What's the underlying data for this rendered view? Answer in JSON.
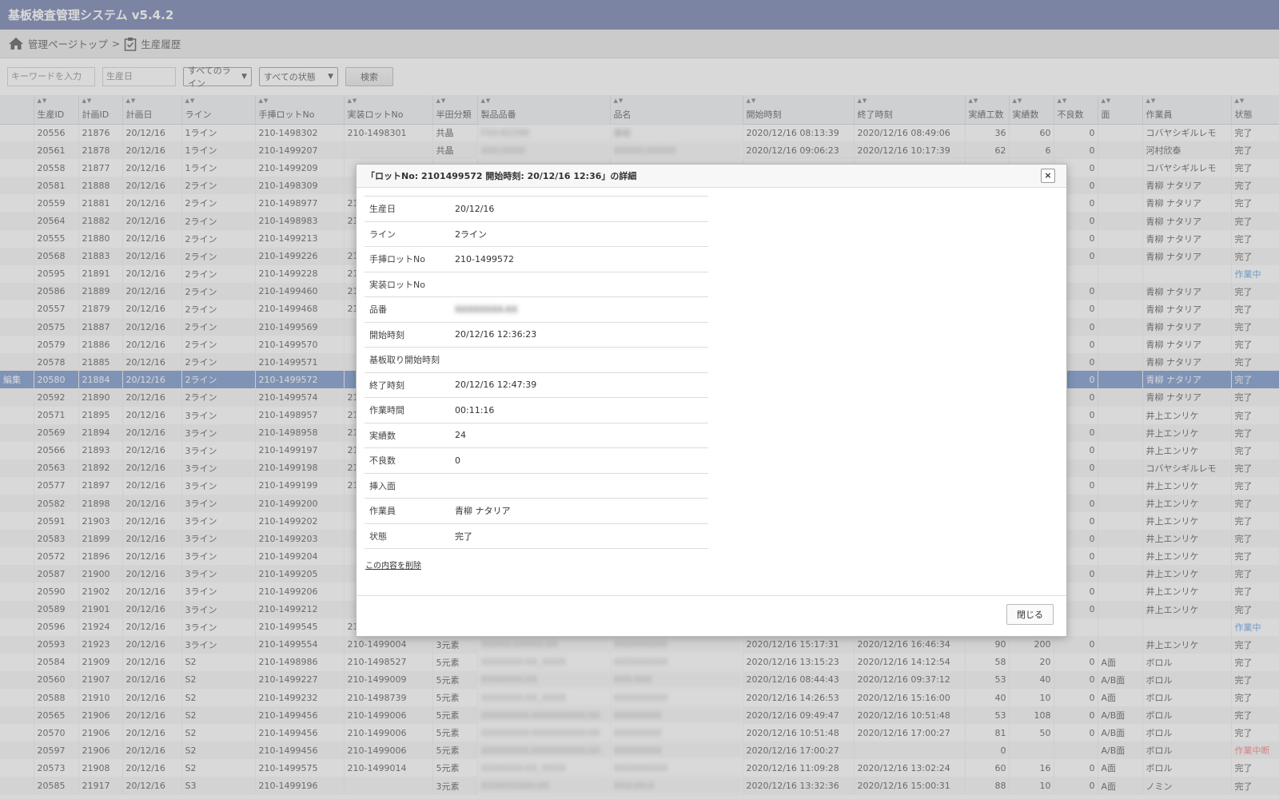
{
  "app": {
    "title": "基板検査管理システム v5.4.2"
  },
  "breadcrumb": {
    "home": "管理ページトップ",
    "separator": ">",
    "current": "生産履歴"
  },
  "search": {
    "keyword_placeholder": "キーワードを入力",
    "date_placeholder": "生産日",
    "line_select": "すべてのライン",
    "status_select": "すべての状態",
    "search_button": "検索"
  },
  "icons": {
    "home": "home-icon",
    "breadcrumb_page": "clipboard-check-icon",
    "close": "close-icon",
    "sort": "sort-arrows-icon"
  },
  "colors": {
    "header": "#56659e",
    "selected_row": "#5c80c0",
    "in_progress": "#3a8be0",
    "stopped": "#e66666"
  },
  "table": {
    "columns": [
      "",
      "生産ID",
      "計画ID",
      "計画日",
      "ライン",
      "手挿ロットNo",
      "実装ロットNo",
      "半田分類",
      "製品品番",
      "品名",
      "開始時刻",
      "終了時刻",
      "実績工数",
      "実績数",
      "不良数",
      "面",
      "作業員",
      "状態"
    ],
    "edit_label": "編集",
    "rows": [
      [
        "",
        "20556",
        "21876",
        "20/12/16",
        "1ライン",
        "210-1498302",
        "210-1498301",
        "共晶",
        "FXX-R2298",
        "基板",
        "2020/12/16 08:13:39",
        "2020/12/16 08:49:06",
        "36",
        "60",
        "0",
        "",
        "コバヤシギルレモ",
        "完了"
      ],
      [
        "",
        "20561",
        "21878",
        "20/12/16",
        "1ライン",
        "210-1499207",
        "",
        "共晶",
        "XXX-XXXX",
        "XXXXX-XXXXX",
        "2020/12/16 09:06:23",
        "2020/12/16 10:17:39",
        "62",
        "6",
        "0",
        "",
        "河村欣泰",
        "完了"
      ],
      [
        "",
        "20558",
        "21877",
        "20/12/16",
        "1ライン",
        "210-1499209",
        "",
        "",
        "",
        "",
        "",
        "",
        "",
        "",
        "0",
        "",
        "コバヤシギルレモ",
        "完了"
      ],
      [
        "",
        "20581",
        "21888",
        "20/12/16",
        "2ライン",
        "210-1498309",
        "",
        "",
        "",
        "",
        "",
        "",
        "",
        "",
        "0",
        "",
        "青柳 ナタリア",
        "完了"
      ],
      [
        "",
        "20559",
        "21881",
        "20/12/16",
        "2ライン",
        "210-1498977",
        "21",
        "",
        "",
        "",
        "",
        "",
        "",
        "",
        "0",
        "",
        "青柳 ナタリア",
        "完了"
      ],
      [
        "",
        "20564",
        "21882",
        "20/12/16",
        "2ライン",
        "210-1498983",
        "21",
        "",
        "",
        "",
        "",
        "",
        "",
        "",
        "0",
        "",
        "青柳 ナタリア",
        "完了"
      ],
      [
        "",
        "20555",
        "21880",
        "20/12/16",
        "2ライン",
        "210-1499213",
        "",
        "",
        "",
        "",
        "",
        "",
        "",
        "",
        "0",
        "",
        "青柳 ナタリア",
        "完了"
      ],
      [
        "",
        "20568",
        "21883",
        "20/12/16",
        "2ライン",
        "210-1499226",
        "21",
        "",
        "",
        "",
        "",
        "",
        "",
        "",
        "0",
        "",
        "青柳 ナタリア",
        "完了"
      ],
      [
        "",
        "20595",
        "21891",
        "20/12/16",
        "2ライン",
        "210-1499228",
        "21",
        "",
        "",
        "",
        "",
        "",
        "",
        "",
        "",
        "",
        "",
        "作業中"
      ],
      [
        "",
        "20586",
        "21889",
        "20/12/16",
        "2ライン",
        "210-1499460",
        "21",
        "",
        "",
        "",
        "",
        "",
        "",
        "",
        "0",
        "",
        "青柳 ナタリア",
        "完了"
      ],
      [
        "",
        "20557",
        "21879",
        "20/12/16",
        "2ライン",
        "210-1499468",
        "21",
        "",
        "",
        "",
        "",
        "",
        "",
        "",
        "0",
        "",
        "青柳 ナタリア",
        "完了"
      ],
      [
        "",
        "20575",
        "21887",
        "20/12/16",
        "2ライン",
        "210-1499569",
        "",
        "",
        "",
        "",
        "",
        "",
        "",
        "",
        "0",
        "",
        "青柳 ナタリア",
        "完了"
      ],
      [
        "",
        "20579",
        "21886",
        "20/12/16",
        "2ライン",
        "210-1499570",
        "",
        "",
        "",
        "",
        "",
        "",
        "",
        "",
        "0",
        "",
        "青柳 ナタリア",
        "完了"
      ],
      [
        "",
        "20578",
        "21885",
        "20/12/16",
        "2ライン",
        "210-1499571",
        "",
        "",
        "",
        "",
        "",
        "",
        "",
        "",
        "0",
        "",
        "青柳 ナタリア",
        "完了"
      ],
      [
        "編集",
        "20580",
        "21884",
        "20/12/16",
        "2ライン",
        "210-1499572",
        "",
        "",
        "",
        "",
        "",
        "",
        "",
        "",
        "0",
        "",
        "青柳 ナタリア",
        "完了"
      ],
      [
        "",
        "20592",
        "21890",
        "20/12/16",
        "2ライン",
        "210-1499574",
        "21",
        "",
        "",
        "",
        "",
        "",
        "",
        "",
        "0",
        "",
        "青柳 ナタリア",
        "完了"
      ],
      [
        "",
        "20571",
        "21895",
        "20/12/16",
        "3ライン",
        "210-1498957",
        "21",
        "",
        "",
        "",
        "",
        "",
        "",
        "",
        "0",
        "",
        "井上エンリケ",
        "完了"
      ],
      [
        "",
        "20569",
        "21894",
        "20/12/16",
        "3ライン",
        "210-1498958",
        "21",
        "",
        "",
        "",
        "",
        "",
        "",
        "",
        "0",
        "",
        "井上エンリケ",
        "完了"
      ],
      [
        "",
        "20566",
        "21893",
        "20/12/16",
        "3ライン",
        "210-1499197",
        "21",
        "",
        "",
        "",
        "",
        "",
        "",
        "",
        "0",
        "",
        "井上エンリケ",
        "完了"
      ],
      [
        "",
        "20563",
        "21892",
        "20/12/16",
        "3ライン",
        "210-1499198",
        "21",
        "",
        "",
        "",
        "",
        "",
        "",
        "",
        "0",
        "",
        "コバヤシギルレモ",
        "完了"
      ],
      [
        "",
        "20577",
        "21897",
        "20/12/16",
        "3ライン",
        "210-1499199",
        "21",
        "",
        "",
        "",
        "",
        "",
        "",
        "",
        "0",
        "",
        "井上エンリケ",
        "完了"
      ],
      [
        "",
        "20582",
        "21898",
        "20/12/16",
        "3ライン",
        "210-1499200",
        "",
        "",
        "",
        "",
        "",
        "",
        "",
        "",
        "0",
        "",
        "井上エンリケ",
        "完了"
      ],
      [
        "",
        "20591",
        "21903",
        "20/12/16",
        "3ライン",
        "210-1499202",
        "",
        "",
        "",
        "",
        "",
        "",
        "",
        "",
        "0",
        "",
        "井上エンリケ",
        "完了"
      ],
      [
        "",
        "20583",
        "21899",
        "20/12/16",
        "3ライン",
        "210-1499203",
        "",
        "",
        "",
        "",
        "",
        "",
        "",
        "",
        "0",
        "",
        "井上エンリケ",
        "完了"
      ],
      [
        "",
        "20572",
        "21896",
        "20/12/16",
        "3ライン",
        "210-1499204",
        "",
        "",
        "",
        "",
        "",
        "",
        "",
        "",
        "0",
        "",
        "井上エンリケ",
        "完了"
      ],
      [
        "",
        "20587",
        "21900",
        "20/12/16",
        "3ライン",
        "210-1499205",
        "",
        "",
        "",
        "",
        "",
        "",
        "",
        "",
        "0",
        "",
        "井上エンリケ",
        "完了"
      ],
      [
        "",
        "20590",
        "21902",
        "20/12/16",
        "3ライン",
        "210-1499206",
        "",
        "",
        "",
        "",
        "",
        "",
        "",
        "",
        "0",
        "",
        "井上エンリケ",
        "完了"
      ],
      [
        "",
        "20589",
        "21901",
        "20/12/16",
        "3ライン",
        "210-1499212",
        "",
        "",
        "",
        "",
        "",
        "",
        "",
        "",
        "0",
        "",
        "井上エンリケ",
        "完了"
      ],
      [
        "",
        "20596",
        "21924",
        "20/12/16",
        "3ライン",
        "210-1499545",
        "21",
        "",
        "",
        "",
        "",
        "",
        "",
        "",
        "",
        "",
        "",
        "作業中"
      ],
      [
        "",
        "20593",
        "21923",
        "20/12/16",
        "3ライン",
        "210-1499554",
        "210-1499004",
        "3元素",
        "XXXXX-XXXXX-XX",
        "XXXXXXXXX",
        "2020/12/16 15:17:31",
        "2020/12/16 16:46:34",
        "90",
        "200",
        "0",
        "",
        "井上エンリケ",
        "完了"
      ],
      [
        "",
        "20584",
        "21909",
        "20/12/16",
        "S2",
        "210-1498986",
        "210-1498527",
        "5元素",
        "XXXXXXX-XX_XXXX",
        "XXXXXXXXX",
        "2020/12/16 13:15:23",
        "2020/12/16 14:12:54",
        "58",
        "20",
        "0",
        "A面",
        "ボロル",
        "完了"
      ],
      [
        "",
        "20560",
        "21907",
        "20/12/16",
        "S2",
        "210-1499227",
        "210-1499009",
        "5元素",
        "XXXXXXX-XX",
        "XXX-XXX",
        "2020/12/16 08:44:43",
        "2020/12/16 09:37:12",
        "53",
        "40",
        "0",
        "A/B面",
        "ボロル",
        "完了"
      ],
      [
        "",
        "20588",
        "21910",
        "20/12/16",
        "S2",
        "210-1499232",
        "210-1498739",
        "5元素",
        "XXXXXXX-XX_XXXX",
        "XXXXXXXXX",
        "2020/12/16 14:26:53",
        "2020/12/16 15:16:00",
        "40",
        "10",
        "0",
        "A面",
        "ボロル",
        "完了"
      ],
      [
        "",
        "20565",
        "21906",
        "20/12/16",
        "S2",
        "210-1499456",
        "210-1499006",
        "5元素",
        "XXXXXXXX-XXXXXXXXX-XX",
        "XXXXXXXX",
        "2020/12/16 09:49:47",
        "2020/12/16 10:51:48",
        "53",
        "108",
        "0",
        "A/B面",
        "ボロル",
        "完了"
      ],
      [
        "",
        "20570",
        "21906",
        "20/12/16",
        "S2",
        "210-1499456",
        "210-1499006",
        "5元素",
        "XXXXXXXX-XXXXXXXXX-XX",
        "XXXXXXXX",
        "2020/12/16 10:51:48",
        "2020/12/16 17:00:27",
        "81",
        "50",
        "0",
        "A/B面",
        "ボロル",
        "完了"
      ],
      [
        "",
        "20597",
        "21906",
        "20/12/16",
        "S2",
        "210-1499456",
        "210-1499006",
        "5元素",
        "XXXXXXXX-XXXXXXXXX-XX",
        "XXXXXXXX",
        "2020/12/16 17:00:27",
        "",
        "0",
        "",
        "",
        "A/B面",
        "ボロル",
        "作業中断"
      ],
      [
        "",
        "20573",
        "21908",
        "20/12/16",
        "S2",
        "210-1499575",
        "210-1499014",
        "5元素",
        "XXXXXXX-XX_XXXX",
        "XXXXXXXXX",
        "2020/12/16 11:09:28",
        "2020/12/16 13:02:24",
        "60",
        "16",
        "0",
        "A面",
        "ボロル",
        "完了"
      ],
      [
        "",
        "20585",
        "21917",
        "20/12/16",
        "S3",
        "210-1499196",
        "",
        "3元素",
        "XXXXXXXXX-XX",
        "XXX-XX-X",
        "2020/12/16 13:32:36",
        "2020/12/16 15:00:31",
        "88",
        "10",
        "0",
        "A面",
        "ノミン",
        "完了"
      ]
    ]
  },
  "modal": {
    "title": "「ロットNo: 2101499572 開始時刻: 20/12/16 12:36」の詳細",
    "fields": [
      {
        "label": "生産日",
        "value": "20/12/16"
      },
      {
        "label": "ライン",
        "value": "2ライン"
      },
      {
        "label": "手挿ロットNo",
        "value": "210-1499572"
      },
      {
        "label": "実装ロットNo",
        "value": ""
      },
      {
        "label": "品番",
        "value": "XXXXXXXX-XX"
      },
      {
        "label": "開始時刻",
        "value": "20/12/16 12:36:23"
      },
      {
        "label": "基板取り開始時刻",
        "value": ""
      },
      {
        "label": "終了時刻",
        "value": "20/12/16 12:47:39"
      },
      {
        "label": "作業時間",
        "value": "00:11:16"
      },
      {
        "label": "実績数",
        "value": "24"
      },
      {
        "label": "不良数",
        "value": "0"
      },
      {
        "label": "挿入面",
        "value": ""
      },
      {
        "label": "作業員",
        "value": "青柳 ナタリア"
      },
      {
        "label": "状態",
        "value": "完了"
      }
    ],
    "delete_link": "この内容を削除",
    "close_button": "閉じる",
    "close_icon": "×"
  }
}
